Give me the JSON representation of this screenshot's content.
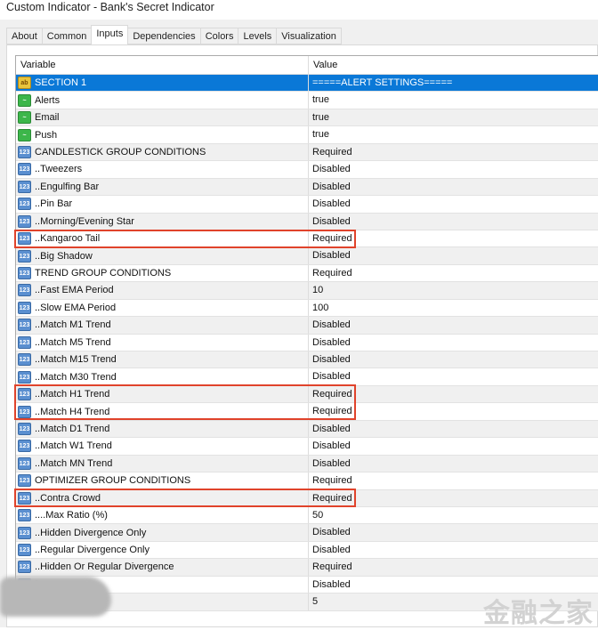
{
  "window": {
    "title": "Custom Indicator - Bank's Secret Indicator"
  },
  "tabs": [
    {
      "label": "About"
    },
    {
      "label": "Common"
    },
    {
      "label": "Inputs",
      "active": true
    },
    {
      "label": "Dependencies"
    },
    {
      "label": "Colors"
    },
    {
      "label": "Levels"
    },
    {
      "label": "Visualization"
    }
  ],
  "table": {
    "headers": {
      "variable": "Variable",
      "value": "Value"
    },
    "rows": [
      {
        "icon": "ab",
        "variable": "SECTION 1",
        "value": "=====ALERT SETTINGS=====",
        "selected": true
      },
      {
        "icon": "bool",
        "variable": "Alerts",
        "value": "true"
      },
      {
        "icon": "bool",
        "variable": "Email",
        "value": "true"
      },
      {
        "icon": "bool",
        "variable": "Push",
        "value": "true"
      },
      {
        "icon": "num",
        "variable": "CANDLESTICK GROUP CONDITIONS",
        "value": "Required"
      },
      {
        "icon": "num",
        "variable": "..Tweezers",
        "value": "Disabled"
      },
      {
        "icon": "num",
        "variable": "..Engulfing Bar",
        "value": "Disabled"
      },
      {
        "icon": "num",
        "variable": "..Pin Bar",
        "value": "Disabled"
      },
      {
        "icon": "num",
        "variable": "..Morning/Evening Star",
        "value": "Disabled"
      },
      {
        "icon": "num",
        "variable": "..Kangaroo Tail",
        "value": "Required",
        "highlighted": true
      },
      {
        "icon": "num",
        "variable": "..Big Shadow",
        "value": "Disabled"
      },
      {
        "icon": "num",
        "variable": "TREND GROUP CONDITIONS",
        "value": "Required"
      },
      {
        "icon": "num",
        "variable": "..Fast EMA Period",
        "value": "10"
      },
      {
        "icon": "num",
        "variable": "..Slow EMA Period",
        "value": "100"
      },
      {
        "icon": "num",
        "variable": "..Match M1 Trend",
        "value": "Disabled"
      },
      {
        "icon": "num",
        "variable": "..Match M5 Trend",
        "value": "Disabled"
      },
      {
        "icon": "num",
        "variable": "..Match M15 Trend",
        "value": "Disabled"
      },
      {
        "icon": "num",
        "variable": "..Match M30 Trend",
        "value": "Disabled"
      },
      {
        "icon": "num",
        "variable": "..Match H1 Trend",
        "value": "Required",
        "highlighted": true
      },
      {
        "icon": "num",
        "variable": "..Match H4 Trend",
        "value": "Required",
        "highlighted": true
      },
      {
        "icon": "num",
        "variable": "..Match D1 Trend",
        "value": "Disabled"
      },
      {
        "icon": "num",
        "variable": "..Match W1 Trend",
        "value": "Disabled"
      },
      {
        "icon": "num",
        "variable": "..Match MN Trend",
        "value": "Disabled"
      },
      {
        "icon": "num",
        "variable": "OPTIMIZER GROUP CONDITIONS",
        "value": "Required"
      },
      {
        "icon": "num",
        "variable": "..Contra Crowd",
        "value": "Required",
        "highlighted": true
      },
      {
        "icon": "num",
        "variable": "....Max Ratio (%)",
        "value": "50"
      },
      {
        "icon": "num",
        "variable": "..Hidden Divergence Only",
        "value": "Disabled"
      },
      {
        "icon": "num",
        "variable": "..Regular Divergence Only",
        "value": "Disabled"
      },
      {
        "icon": "num",
        "variable": "..Hidden Or Regular Divergence",
        "value": "Required"
      },
      {
        "icon": "num",
        "variable": "ft",
        "value": "Disabled"
      },
      {
        "icon": "num",
        "variable": "es",
        "value": "5"
      }
    ]
  },
  "watermark": "金融之家",
  "colors": {
    "selection": "#0a78d7",
    "highlight_box": "#e0432b"
  }
}
